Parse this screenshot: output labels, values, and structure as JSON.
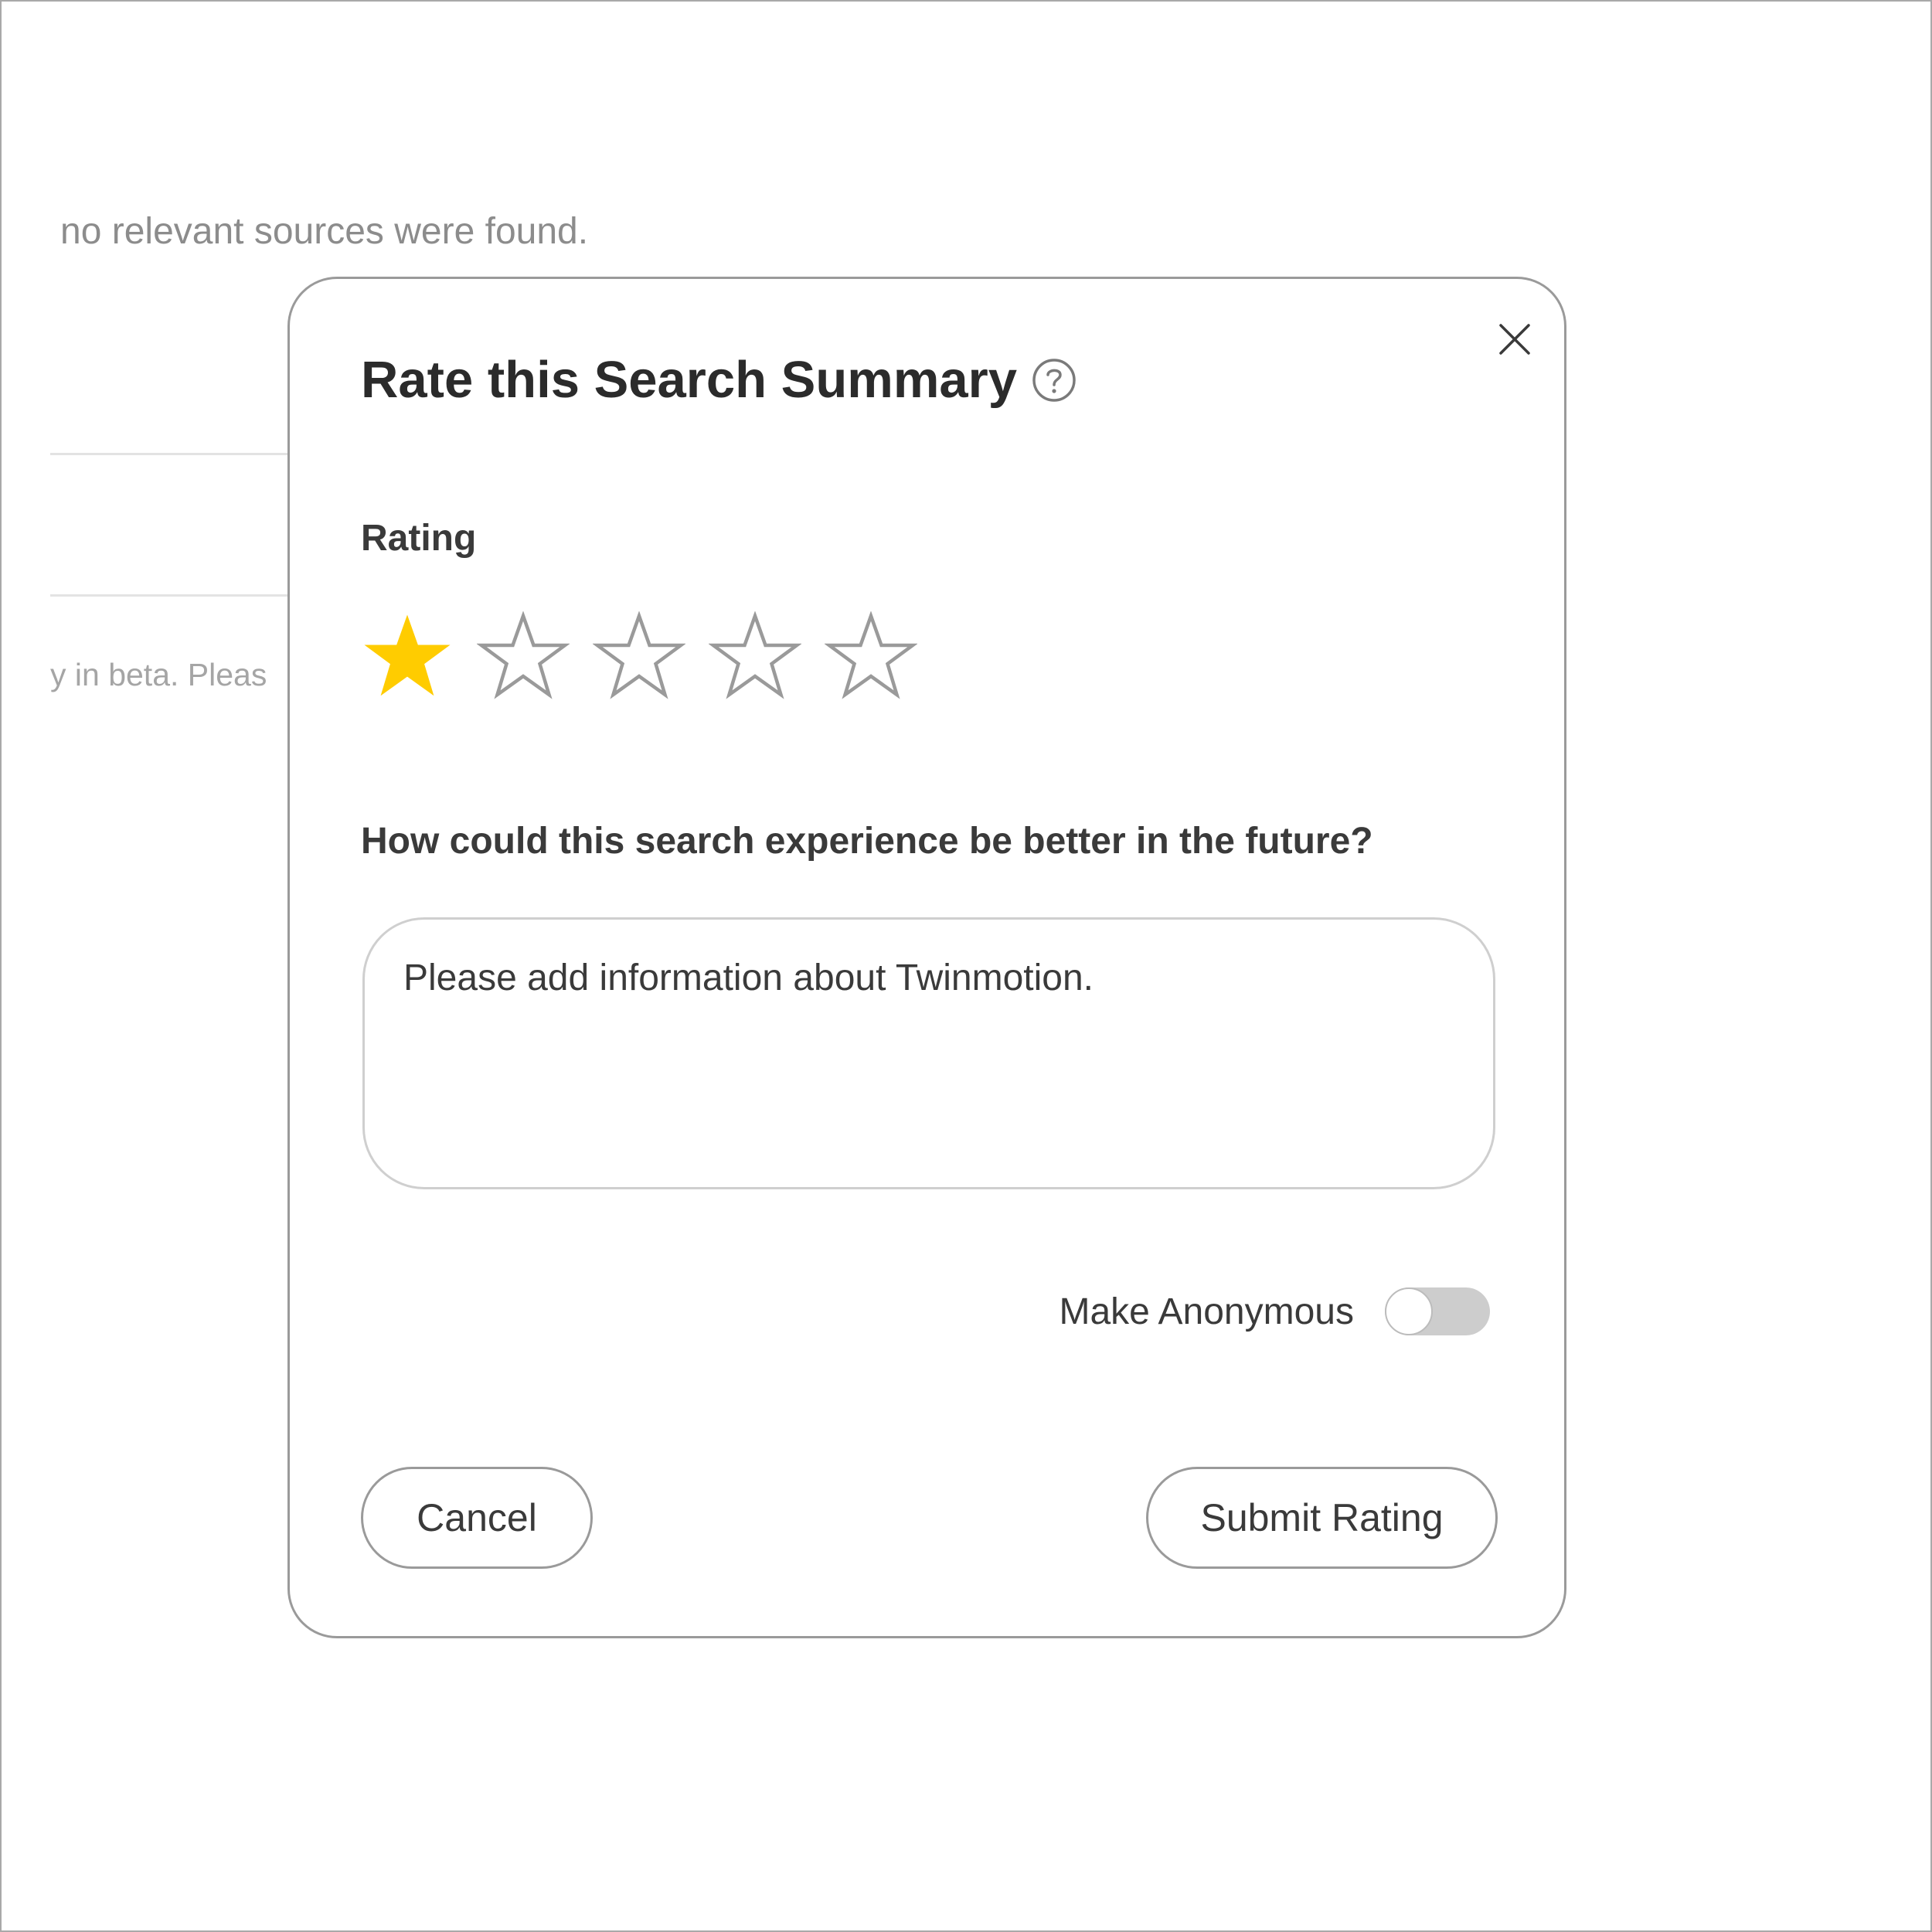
{
  "background": {
    "sources_text": "no relevant sources were found.",
    "beta_text": "y in beta. Pleas"
  },
  "dialog": {
    "title": "Rate this Search Summary",
    "help_icon": "question-circle-icon",
    "close_icon": "close-icon",
    "rating": {
      "label": "Rating",
      "max": 5,
      "value": 1,
      "filled_color": "#FFCC00",
      "empty_color": "#9a9a9a"
    },
    "question": "How could this search experience be better in the future?",
    "feedback": {
      "value": "Please add information about Twinmotion."
    },
    "anonymous": {
      "label": "Make Anonymous",
      "enabled": false
    },
    "cancel_label": "Cancel",
    "submit_label": "Submit Rating"
  }
}
